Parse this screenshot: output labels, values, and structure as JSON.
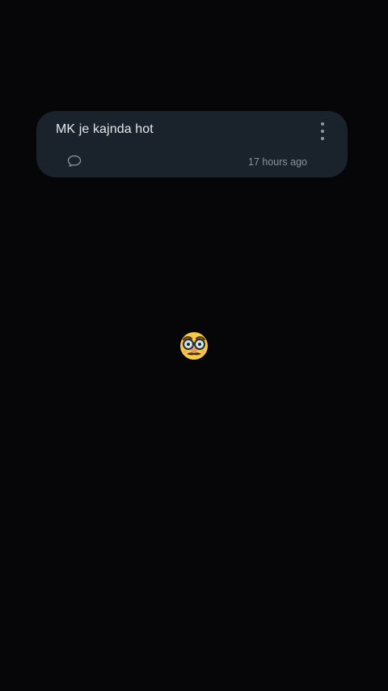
{
  "post": {
    "text": "MK je kajnda hot",
    "timestamp": "17 hours ago",
    "more_icon": "more-vertical-icon",
    "comment_icon": "comment-icon"
  },
  "center": {
    "emoji_icon": "disguised-face-emoji-icon"
  }
}
